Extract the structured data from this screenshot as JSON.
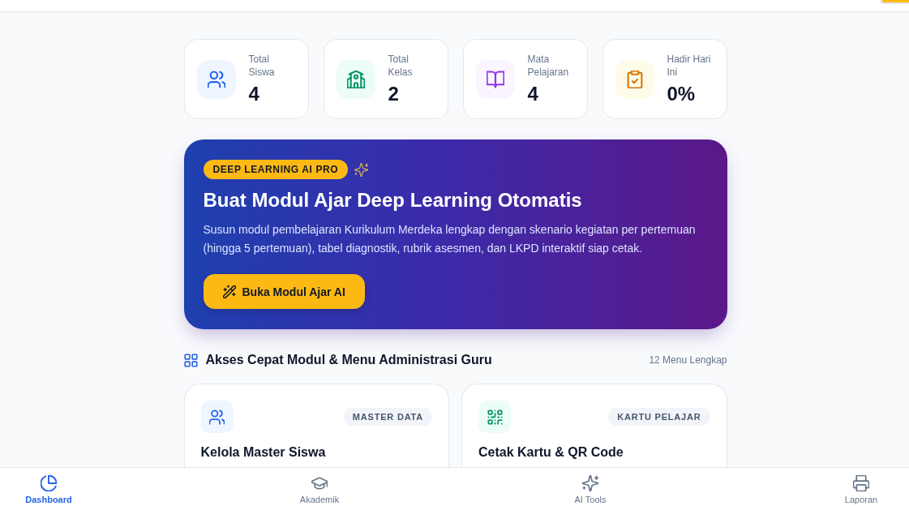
{
  "stats": [
    {
      "kind": "students",
      "label": "Total Siswa",
      "value": "4"
    },
    {
      "kind": "classes",
      "label": "Total Kelas",
      "value": "2"
    },
    {
      "kind": "subjects",
      "label": "Mata Pelajaran",
      "value": "4"
    },
    {
      "kind": "attendance",
      "label": "Hadir Hari Ini",
      "value": "0%"
    }
  ],
  "banner": {
    "badge": "DEEP LEARNING AI PRO",
    "title": "Buat Modul Ajar Deep Learning Otomatis",
    "description": "Susun modul pembelajaran Kurikulum Merdeka lengkap dengan skenario kegiatan per pertemuan (hingga 5 pertemuan), tabel diagnostik, rubrik asesmen, dan LKPD interaktif siap cetak.",
    "button": "Buka Modul Ajar AI"
  },
  "quick_access": {
    "title": "Akses Cepat Modul & Menu Administrasi Guru",
    "count": "12 Menu Lengkap",
    "items": [
      {
        "kind": "students",
        "tag": "MASTER DATA",
        "title": "Kelola Master Siswa"
      },
      {
        "kind": "cards",
        "tag": "KARTU PELAJAR",
        "title": "Cetak Kartu & QR Code"
      }
    ]
  },
  "bottom_nav": [
    {
      "kind": "dashboard",
      "label": "Dashboard",
      "selected": true
    },
    {
      "kind": "academic",
      "label": "Akademik",
      "selected": false
    },
    {
      "kind": "ai",
      "label": "AI Tools",
      "selected": false
    },
    {
      "kind": "report",
      "label": "Laporan",
      "selected": false
    }
  ]
}
